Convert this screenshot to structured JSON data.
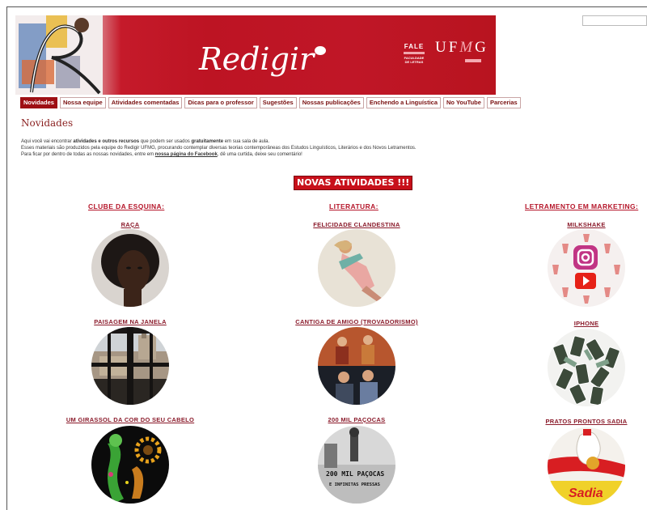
{
  "banner": {
    "logo_text": "Redigir",
    "fale_title": "FALE",
    "fale_sub_1": "FACULDADE",
    "fale_sub_2": "DE LETRAS",
    "ufmg_prefix": "UF",
    "ufmg_m": "M",
    "ufmg_suffix": "G"
  },
  "nav": {
    "tabs": [
      {
        "label": "Novidades",
        "active": true
      },
      {
        "label": "Nossa equipe"
      },
      {
        "label": "Atividades comentadas"
      },
      {
        "label": "Dicas para o professor"
      },
      {
        "label": "Sugestões"
      },
      {
        "label": "Nossas publicações"
      },
      {
        "label": "Enchendo a Linguística"
      },
      {
        "label": "No YouTube"
      },
      {
        "label": "Parcerias"
      }
    ]
  },
  "page": {
    "title": "Novidades",
    "intro_1a": "Aqui você vai encontrar ",
    "intro_1b": "atividades e outros recursos",
    "intro_1c": " que podem ser usados ",
    "intro_1d": "gratuitamente",
    "intro_1e": " em sua sala de aula.",
    "intro_2": "Esses materiais são produzidos pela equipe do Redigir UFMG, procurando contemplar diversas teorias contemporâneas dos Estudos Linguísticos, Literários e dos Novos Letramentos.",
    "intro_3a": "Para ficar por dentro de todas as nossas novidades, entre em ",
    "intro_3b": "nossa página do Facebook",
    "intro_3c": ", dê uma curtida, deixe seu comentário!",
    "news_heading": "NOVAS ATIVIDADES !!!"
  },
  "columns": [
    {
      "category": "CLUBE DA ESQUINA:",
      "items": [
        "RAÇA",
        "PAISAGEM NA JANELA",
        "UM GIRASSOL DA COR DO SEU CABELO"
      ]
    },
    {
      "category": "LITERATURA:",
      "items": [
        "FELICIDADE CLANDESTINA",
        "CANTIGA DE AMIGO (TROVADORISMO)",
        "200 MIL PAÇOCAS"
      ]
    },
    {
      "category": "LETRAMENTO EM MARKETING:",
      "items": [
        "MILKSHAKE",
        "IPHONE",
        "PRATOS PRONTOS SADIA"
      ]
    }
  ],
  "graffiti_text_1": "200 MIL PAÇOCAS",
  "graffiti_text_2": "E INFINITAS PRESSAS",
  "sadia_text": "Sadia",
  "colors": {
    "brand_red": "#c01627",
    "tab_active": "#9e0f14",
    "link_red": "#b5162a"
  }
}
